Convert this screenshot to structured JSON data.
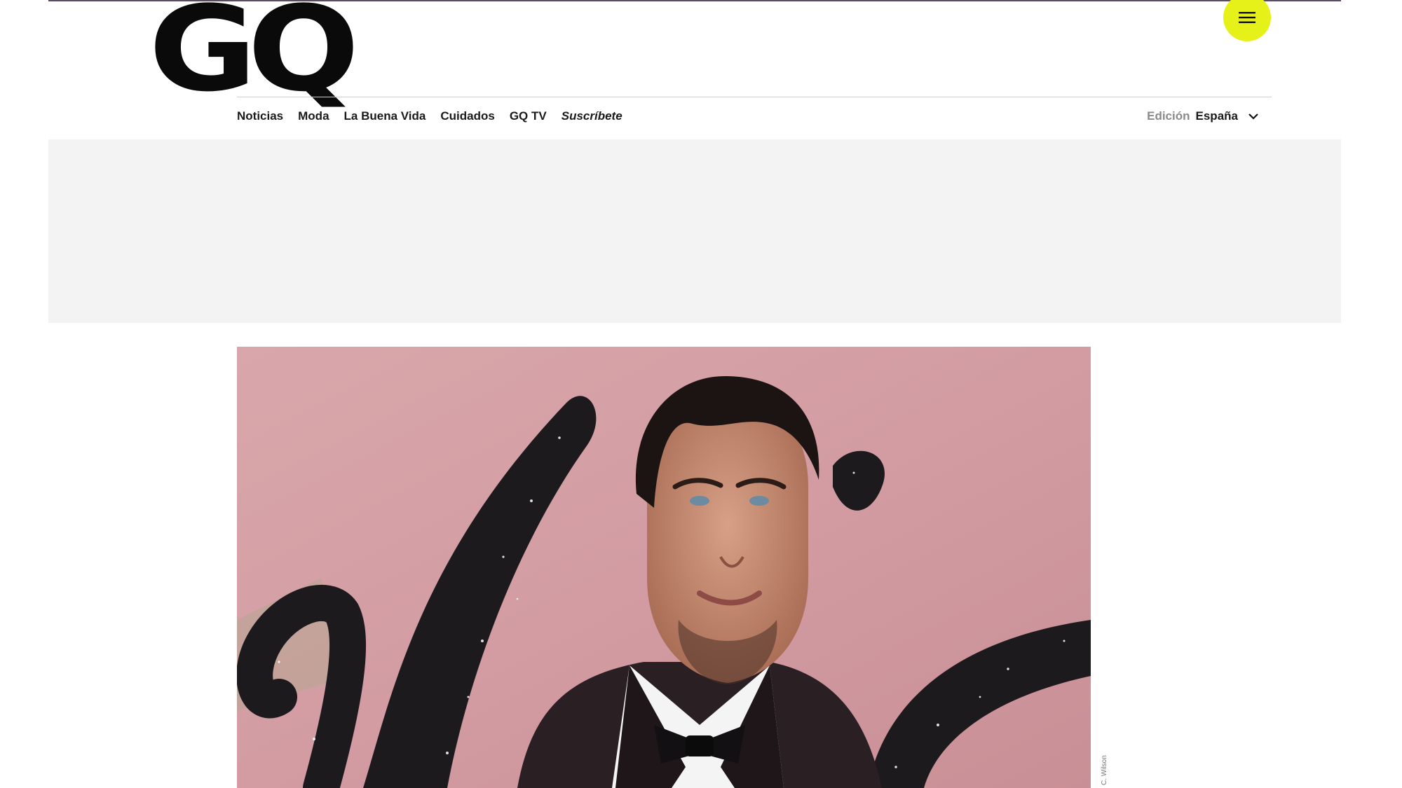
{
  "brand": {
    "logo_text": "GQ",
    "accent_color": "#e6f019"
  },
  "header": {
    "menu_icon": "hamburger-icon"
  },
  "nav": {
    "items": [
      {
        "label": "Noticias"
      },
      {
        "label": "Moda"
      },
      {
        "label": "La Buena Vida"
      },
      {
        "label": "Cuidados"
      },
      {
        "label": "GQ TV"
      },
      {
        "label": "Suscríbete"
      }
    ]
  },
  "edition": {
    "label": "Edición",
    "value": "España",
    "icon": "chevron-down-icon"
  },
  "hero": {
    "credit": "C. Wilson"
  }
}
